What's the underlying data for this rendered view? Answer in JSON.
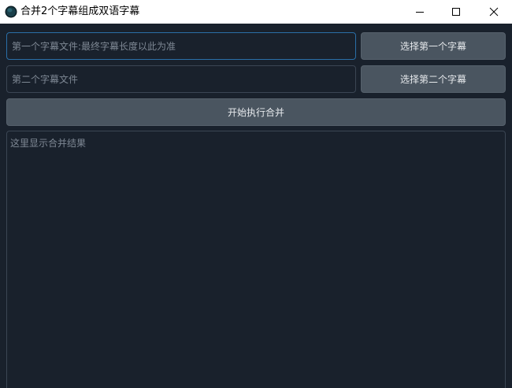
{
  "window": {
    "title": "合并2个字幕组成双语字幕",
    "icon": "app-globe-icon"
  },
  "controls": {
    "minimize_icon": "minimize-icon",
    "maximize_icon": "maximize-icon",
    "close_icon": "close-icon"
  },
  "form": {
    "first_file": {
      "value": "",
      "placeholder": "第一个字幕文件:最终字幕长度以此为准"
    },
    "second_file": {
      "value": "",
      "placeholder": "第二个字幕文件"
    },
    "choose_first_label": "选择第一个字幕",
    "choose_second_label": "选择第二个字幕",
    "run_label": "开始执行合并"
  },
  "result": {
    "value": "",
    "placeholder": "这里显示合并结果"
  },
  "colors": {
    "background": "#19212c",
    "button": "#4a5560",
    "border": "#3b4654",
    "focus_border": "#2a6fa8"
  }
}
